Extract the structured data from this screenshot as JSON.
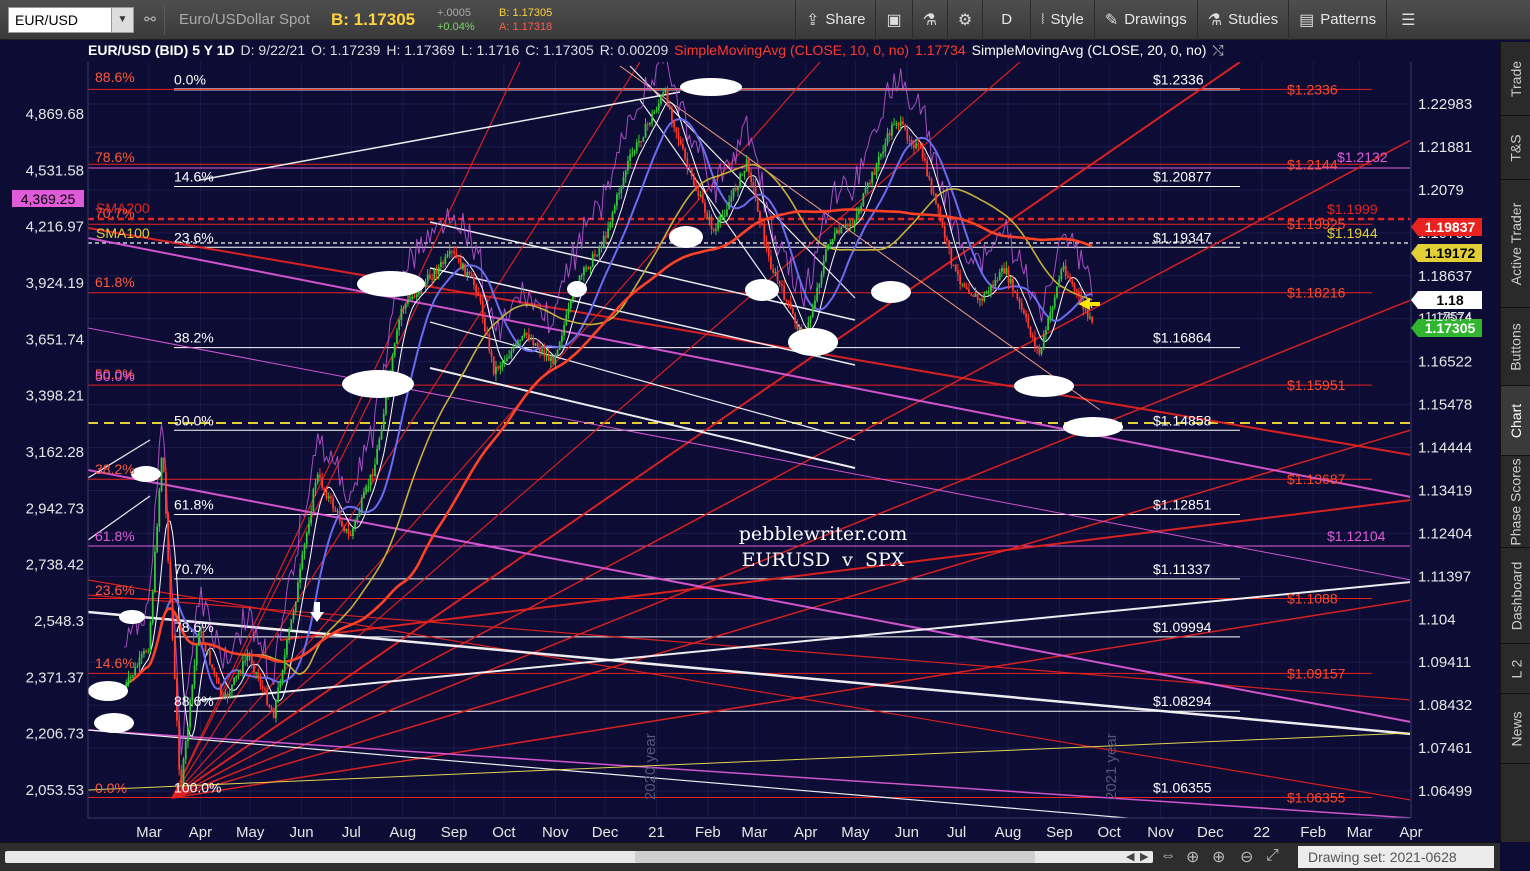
{
  "toolbar": {
    "symbol": "EUR/USD",
    "description": "Euro/USDollar Spot",
    "bid_label": "B: 1.17305",
    "change_abs": "+.0005",
    "change_pct": "+0.04%",
    "bid_small": "B: 1.17305",
    "ask_small": "A: 1.17318",
    "share": "Share",
    "period": "D",
    "style": "Style",
    "drawings": "Drawings",
    "studies": "Studies",
    "patterns": "Patterns"
  },
  "chart_header": {
    "symbol": "EUR/USD (BID) 5 Y 1D",
    "date": "D: 9/22/21",
    "open": "O: 1.17239",
    "high": "H: 1.17369",
    "low": "L: 1.1716",
    "close": "C: 1.17305",
    "range": "R: 0.00209",
    "sma10_label": "SimpleMovingAvg (CLOSE, 10, 0, no)",
    "sma10_value": "1.17734",
    "sma20_label": "SimpleMovingAvg (CLOSE, 20, 0, no)"
  },
  "side_tabs": [
    "Trade",
    "T&S",
    "Active Trader",
    "Buttons",
    "Chart",
    "Phase Scores",
    "Dashboard",
    "L 2",
    "News"
  ],
  "bottom_bar": {
    "drawing_set": "Drawing set: 2021-0628"
  },
  "watermark": {
    "line1": "pebblewriter.com",
    "line2": "EURUSD  v  SPX"
  },
  "price_badges": [
    {
      "text": "1.19837",
      "color": "#e8231f",
      "text_color": "#ffffff"
    },
    {
      "text": "1.19172",
      "color": "#e2cf35",
      "text_color": "#000000"
    },
    {
      "text": "1.18",
      "color": "#ffffff",
      "text_color": "#000000"
    },
    {
      "text": "1.17305",
      "color": "#2fb52f",
      "text_color": "#ffffff"
    }
  ],
  "left_badges": [
    {
      "text": "4,369.25",
      "color": "#e05bd8",
      "text_color": "#000000"
    }
  ],
  "fib_labels_white": [
    {
      "pct": "0.0%",
      "price": "$1.2336"
    },
    {
      "pct": "14.6%",
      "price": "$1.20877"
    },
    {
      "pct": "23.6%",
      "price": "$1.19347"
    },
    {
      "pct": "38.2%",
      "price": "$1.16864"
    },
    {
      "pct": "50.0%",
      "price": "$1.14858"
    },
    {
      "pct": "61.8%",
      "price": "$1.12851"
    },
    {
      "pct": "70.7%",
      "price": "$1.11337"
    },
    {
      "pct": "78.6%",
      "price": "$1.09994"
    },
    {
      "pct": "88.6%",
      "price": "$1.08294"
    },
    {
      "pct": "100.0%",
      "price": "$1.06355"
    }
  ],
  "fib_labels_red": [
    {
      "pct": "88.6%",
      "price": "$1.2336"
    },
    {
      "pct": "78.6%",
      "price": "$1.2144"
    },
    {
      "pct": "70.7%",
      "price": "$1.19925"
    },
    {
      "pct": "61.8%",
      "price": "$1.18216"
    },
    {
      "pct": "50.0%",
      "price": "$1.15951"
    },
    {
      "pct": "38.2%",
      "price": "$1.13687"
    },
    {
      "pct": "23.6%",
      "price": "$1.1088"
    },
    {
      "pct": "14.6%",
      "price": "$1.09157"
    },
    {
      "pct": "0.0%",
      "price": "$1.06355"
    }
  ],
  "other_labels": [
    {
      "text": "50.0%",
      "color": "#e05bd8"
    },
    {
      "text": "61.8%",
      "color": "#e05bd8"
    },
    {
      "text": "$1.2132",
      "color": "#e05bd8"
    },
    {
      "text": "$1.12104",
      "color": "#e05bd8"
    },
    {
      "text": "$1.1999",
      "color": "#e8231f"
    },
    {
      "text": "$1.1944",
      "color": "#e2cf35"
    },
    {
      "text": "SMA200",
      "color": "#e8231f"
    },
    {
      "text": "SMA100",
      "color": "#e2cf35"
    },
    {
      "text": "2020 year",
      "color": "#555577"
    },
    {
      "text": "2021 year",
      "color": "#555577"
    }
  ],
  "chart_data": {
    "type": "candlestick",
    "series": [
      {
        "name": "EUR/USD"
      },
      {
        "name": "SimpleMovingAvg (CLOSE, 10, 0, no)"
      },
      {
        "name": "SimpleMovingAvg (CLOSE, 20, 0, no)"
      },
      {
        "name": "SMA100"
      },
      {
        "name": "SMA200"
      }
    ],
    "x_ticks": [
      "Mar",
      "Apr",
      "May",
      "Jun",
      "Jul",
      "Aug",
      "Sep",
      "Oct",
      "Nov",
      "Dec",
      "21",
      "Feb",
      "Mar",
      "Apr",
      "May",
      "Jun",
      "Jul",
      "Aug",
      "Sep",
      "Oct",
      "Nov",
      "Dec",
      "22",
      "Feb",
      "Mar",
      "Apr"
    ],
    "y_right_ticks": [
      "1.22983",
      "1.21881",
      "1.2079",
      "1.19708",
      "1.18637",
      "1.17574",
      "1.16522",
      "1.15478",
      "1.14444",
      "1.13419",
      "1.12404",
      "1.11397",
      "1.104",
      "1.09411",
      "1.08432",
      "1.07461",
      "1.06499"
    ],
    "y_left_ticks": [
      "4,869.68",
      "4,531.58",
      "4,216.97",
      "3,924.19",
      "3,651.74",
      "3,398.21",
      "3,162.28",
      "2,942.73",
      "2,738.42",
      "2,548.3",
      "2,371.37",
      "2,206.73",
      "2,053.53"
    ],
    "x_range": [
      "2020-02",
      "2022-04"
    ],
    "y_range": [
      1.06,
      1.235
    ],
    "ylim_left": [
      2000,
      5000
    ],
    "log_scale": true,
    "last_price": 1.17305,
    "ohlc_points": [
      [
        "2020-02-15",
        1.088
      ],
      [
        "2020-03-01",
        1.098
      ],
      [
        "2020-03-09",
        1.145
      ],
      [
        "2020-03-20",
        1.065
      ],
      [
        "2020-03-31",
        1.102
      ],
      [
        "2020-04-15",
        1.085
      ],
      [
        "2020-04-30",
        1.096
      ],
      [
        "2020-05-15",
        1.082
      ],
      [
        "2020-05-29",
        1.11
      ],
      [
        "2020-06-10",
        1.138
      ],
      [
        "2020-06-30",
        1.123
      ],
      [
        "2020-07-15",
        1.14
      ],
      [
        "2020-07-31",
        1.178
      ],
      [
        "2020-08-15",
        1.185
      ],
      [
        "2020-08-31",
        1.192
      ],
      [
        "2020-09-15",
        1.183
      ],
      [
        "2020-09-25",
        1.163
      ],
      [
        "2020-10-15",
        1.172
      ],
      [
        "2020-10-30",
        1.165
      ],
      [
        "2020-11-15",
        1.185
      ],
      [
        "2020-11-30",
        1.195
      ],
      [
        "2020-12-15",
        1.215
      ],
      [
        "2021-01-06",
        1.233
      ],
      [
        "2021-01-20",
        1.213
      ],
      [
        "2021-02-05",
        1.197
      ],
      [
        "2021-02-25",
        1.215
      ],
      [
        "2021-03-10",
        1.19
      ],
      [
        "2021-03-31",
        1.17
      ],
      [
        "2021-04-15",
        1.195
      ],
      [
        "2021-04-30",
        1.2
      ],
      [
        "2021-05-25",
        1.226
      ],
      [
        "2021-06-10",
        1.217
      ],
      [
        "2021-06-30",
        1.187
      ],
      [
        "2021-07-15",
        1.18
      ],
      [
        "2021-07-30",
        1.188
      ],
      [
        "2021-08-20",
        1.167
      ],
      [
        "2021-09-03",
        1.189
      ],
      [
        "2021-09-22",
        1.173
      ]
    ]
  }
}
